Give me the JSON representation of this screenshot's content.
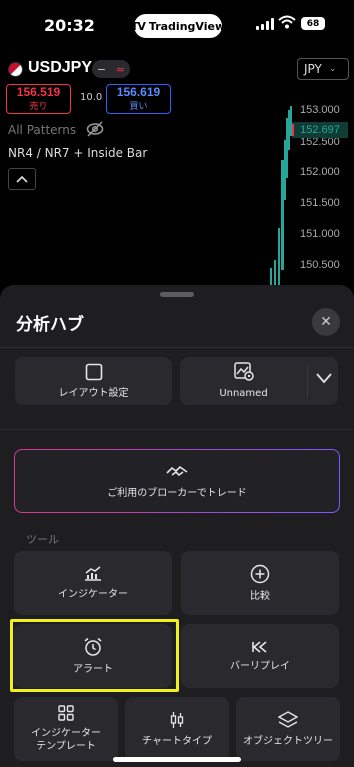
{
  "status_bar": {
    "time": "20:32",
    "app_badge": "TradingView",
    "app_logo_glyph": "TV",
    "battery": "68"
  },
  "chart": {
    "symbol": "USDJPY",
    "toggle_left": "−",
    "toggle_right": "≈",
    "currency": "JPY",
    "sell_price": "156.519",
    "sell_label": "売り",
    "buy_price": "156.619",
    "buy_label": "買い",
    "spread": "10.0",
    "patterns_label": "All Patterns",
    "pattern_name": "NR4 / NR7 + Inside Bar",
    "current_price": "152.697",
    "price_axis": [
      "153.000",
      "152.500",
      "152.000",
      "151.500",
      "151.000",
      "150.500"
    ],
    "candle_color_up": "#26a69a",
    "candle_color_down": "#f23645"
  },
  "sheet": {
    "title": "分析ハブ",
    "close_icon": "close-icon",
    "layout_settings": "レイアウト設定",
    "unnamed": "Unnamed",
    "broker_trade": "ご利用のブローカーでトレード",
    "tools_heading": "ツール",
    "tools": {
      "indicators": "インジケーター",
      "compare": "比較",
      "alert": "アラート",
      "bar_replay": "バーリプレイ",
      "indicator_template_line1": "インジケーター",
      "indicator_template_line2": "テンプレート",
      "chart_type": "チャートタイプ",
      "object_tree": "オブジェクトツリー"
    },
    "highlight_color": "#f0f020"
  }
}
